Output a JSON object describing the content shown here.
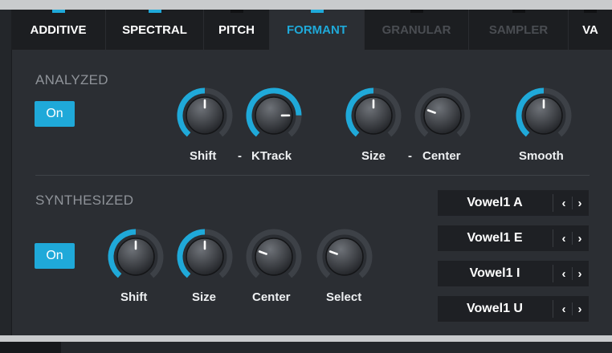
{
  "tabs": [
    {
      "label": "ADDITIVE",
      "state": "normal",
      "indicator": true
    },
    {
      "label": "SPECTRAL",
      "state": "normal",
      "indicator": true
    },
    {
      "label": "PITCH",
      "state": "normal",
      "indicator": false
    },
    {
      "label": "FORMANT",
      "state": "active",
      "indicator": true
    },
    {
      "label": "GRANULAR",
      "state": "disabled",
      "indicator": false
    },
    {
      "label": "SAMPLER",
      "state": "disabled",
      "indicator": false
    },
    {
      "label": "VA",
      "state": "normal",
      "indicator": false
    }
  ],
  "analyzed": {
    "title": "ANALYZED",
    "on_label": "On",
    "knobs": [
      {
        "label": "Shift",
        "value": 0.5,
        "ring_active": true
      },
      {
        "label": "KTrack",
        "value": 0.82,
        "ring_active": true
      },
      {
        "label": "Size",
        "value": 0.5,
        "ring_active": true
      },
      {
        "label": "Center",
        "value": 0.25,
        "ring_active": false
      },
      {
        "label": "Smooth",
        "value": 0.5,
        "ring_active": true
      }
    ],
    "dash": "-"
  },
  "synthesized": {
    "title": "SYNTHESIZED",
    "on_label": "On",
    "knobs": [
      {
        "label": "Shift",
        "value": 0.5,
        "ring_active": true
      },
      {
        "label": "Size",
        "value": 0.5,
        "ring_active": true
      },
      {
        "label": "Center",
        "value": 0.25,
        "ring_active": false
      },
      {
        "label": "Select",
        "value": 0.25,
        "ring_active": false
      }
    ],
    "vowels": [
      {
        "name": "Vowel1 A"
      },
      {
        "name": "Vowel1 E"
      },
      {
        "name": "Vowel1 I"
      },
      {
        "name": "Vowel1 U"
      }
    ],
    "prev_glyph": "‹",
    "next_glyph": "›"
  },
  "colors": {
    "accent": "#1fa9d9",
    "panel": "#2b2e33",
    "tabbar": "#1c1e21"
  }
}
